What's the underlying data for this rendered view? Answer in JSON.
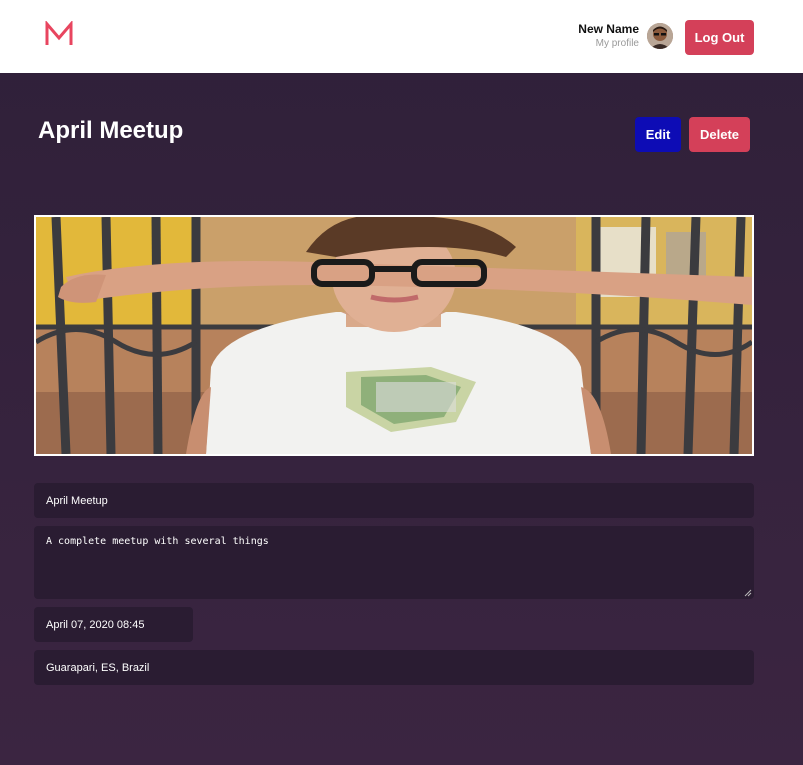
{
  "header": {
    "logo_icon": "meetapp-m-logo",
    "user_name": "New Name",
    "profile_link": "My profile",
    "avatar_icon": "user-avatar",
    "logout_label": "Log Out"
  },
  "meetup": {
    "title": "April Meetup",
    "edit_label": "Edit",
    "delete_label": "Delete",
    "banner": "meetup-banner-image",
    "form": {
      "title_value": "April Meetup",
      "description_value": "A complete meetup with several things",
      "date_value": "April 07, 2020 08:45",
      "location_value": "Guarapari, ES, Brazil"
    }
  },
  "colors": {
    "accent": "#d44059",
    "edit": "#0d0cb5",
    "background_top": "#2f2039",
    "background_bottom": "#3b2541",
    "field_bg": "#2a1c32"
  }
}
